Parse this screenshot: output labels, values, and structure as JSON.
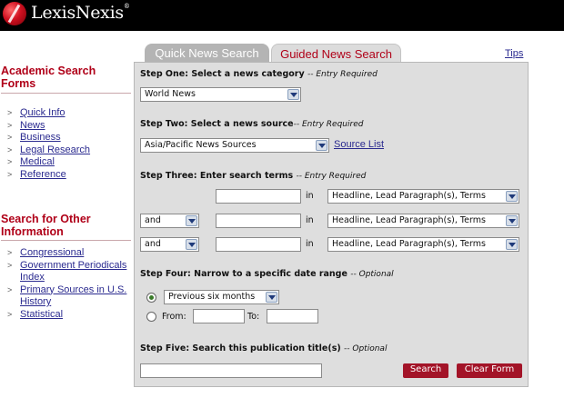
{
  "brand": {
    "name": "LexisNexis",
    "mark": "®"
  },
  "sidebar": {
    "academic": {
      "heading": "Academic Search Forms",
      "items": [
        {
          "label": "Quick Info"
        },
        {
          "label": "News"
        },
        {
          "label": "Business"
        },
        {
          "label": "Legal Research"
        },
        {
          "label": "Medical"
        },
        {
          "label": "Reference"
        }
      ]
    },
    "other": {
      "heading": "Search for Other Information",
      "items": [
        {
          "label": "Congressional"
        },
        {
          "label": "Government Periodicals Index"
        },
        {
          "label": "Primary Sources in U.S. History"
        },
        {
          "label": "Statistical"
        }
      ]
    }
  },
  "tabs": [
    {
      "label": "Quick News Search",
      "active": false
    },
    {
      "label": "Guided News Search",
      "active": true
    }
  ],
  "tips_label": "Tips",
  "step1": {
    "label": "Step One: Select a news category",
    "req": "-- Entry Required",
    "value": "World News"
  },
  "step2": {
    "label": "Step Two: Select a news source",
    "req": "-- Entry Required",
    "value": "Asia/Pacific News Sources",
    "link": "Source List"
  },
  "step3": {
    "label": "Step Three: Enter search terms",
    "req": "-- Entry Required",
    "in_word": "in",
    "rows": [
      {
        "connector": "",
        "term": "",
        "field": "Headline, Lead Paragraph(s), Terms"
      },
      {
        "connector": "and",
        "term": "",
        "field": "Headline, Lead Paragraph(s), Terms"
      },
      {
        "connector": "and",
        "term": "",
        "field": "Headline, Lead Paragraph(s), Terms"
      }
    ]
  },
  "step4": {
    "label": "Step Four: Narrow to a specific date range",
    "opt": "-- Optional",
    "range_value": "Previous six months",
    "from_label": "From:",
    "to_label": "To:"
  },
  "step5": {
    "label": "Step Five: Search this publication title(s)",
    "opt": "-- Optional",
    "search_label": "Search",
    "clear_label": "Clear Form"
  },
  "colors": {
    "accent": "#b00018",
    "button": "#a31428",
    "link": "#2a2a8f",
    "panel": "#dedede"
  }
}
